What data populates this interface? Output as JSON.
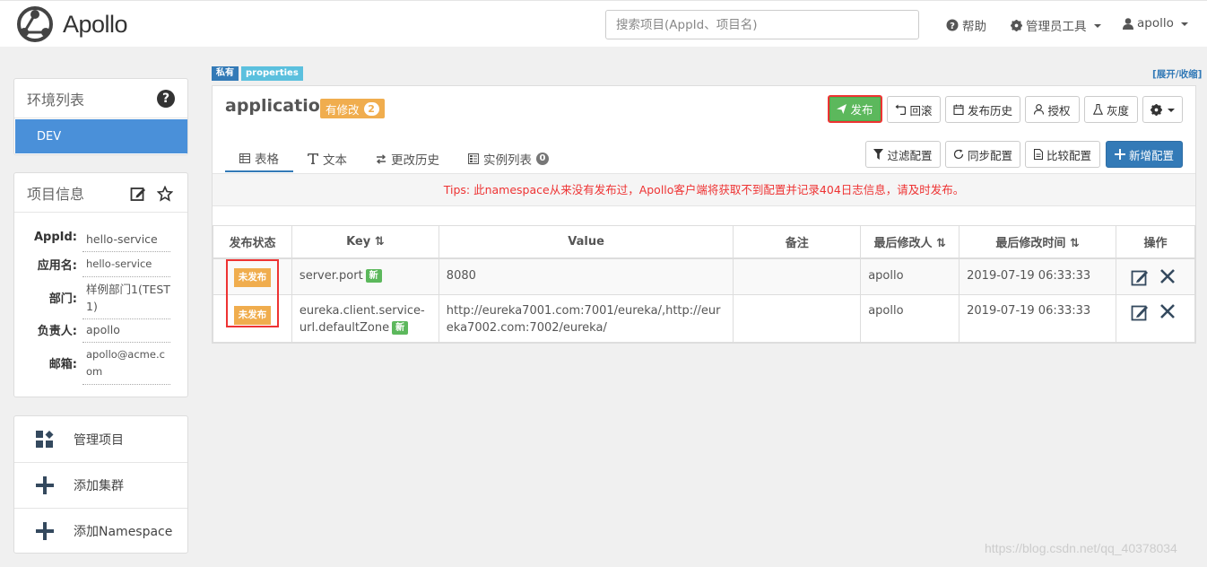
{
  "header": {
    "logo_text": "Apollo",
    "search_placeholder": "搜索项目(AppId、项目名)",
    "help": "帮助",
    "admin_tools": "管理员工具",
    "user": "apollo"
  },
  "env_panel": {
    "title": "环境列表",
    "envs": [
      "DEV"
    ]
  },
  "info_panel": {
    "title": "项目信息",
    "rows": [
      {
        "label": "AppId:",
        "value": "hello-service"
      },
      {
        "label": "应用名:",
        "value": "hello-service"
      },
      {
        "label": "部门:",
        "value": "样例部门1(TEST1)"
      },
      {
        "label": "负责人:",
        "value": "apollo"
      },
      {
        "label": "邮箱:",
        "value": "apollo@acme.com"
      }
    ]
  },
  "actions": {
    "manage_project": "管理项目",
    "add_cluster": "添加集群",
    "add_namespace": "添加Namespace"
  },
  "namespace": {
    "tag_private": "私有",
    "tag_format": "properties",
    "expand": "[展开/收缩]",
    "name": "application",
    "modified_label": "有修改",
    "modified_count": "2",
    "buttons": {
      "publish": "发布",
      "rollback": "回滚",
      "history": "发布历史",
      "grant": "授权",
      "gray": "灰度",
      "filter": "过滤配置",
      "sync": "同步配置",
      "compare": "比较配置",
      "add": "新增配置"
    },
    "tabs": {
      "table": "表格",
      "text": "文本",
      "history": "更改历史",
      "instances": "实例列表",
      "instance_count": "0"
    },
    "tips": "Tips: 此namespace从来没有发布过，Apollo客户端将获取不到配置并记录404日志信息，请及时发布。"
  },
  "table": {
    "headers": {
      "status": "发布状态",
      "key": "Key",
      "value": "Value",
      "comment": "备注",
      "modifier": "最后修改人",
      "modified_time": "最后修改时间",
      "ops": "操作"
    },
    "rows": [
      {
        "status": "未发布",
        "key": "server.port",
        "new_badge": "新",
        "value": "8080",
        "comment": "",
        "modifier": "apollo",
        "time": "2019-07-19 06:33:33"
      },
      {
        "status": "未发布",
        "key": "eureka.client.service-url.defaultZone",
        "new_badge": "新",
        "value": "http://eureka7001.com:7001/eureka/,http://eureka7002.com:7002/eureka/",
        "comment": "",
        "modifier": "apollo",
        "time": "2019-07-19 06:33:33"
      }
    ]
  },
  "watermark": "https://blog.csdn.net/qq_40378034"
}
